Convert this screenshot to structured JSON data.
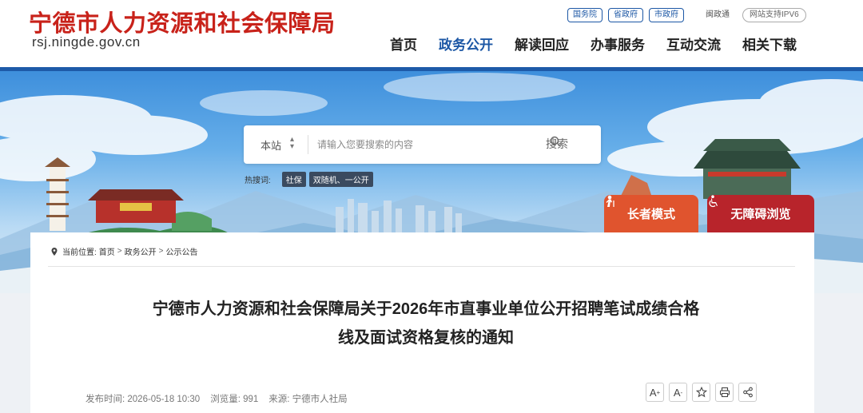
{
  "header": {
    "site_name": "宁德市人力资源和社会保障局",
    "domain": "rsj.ningde.gov.cn",
    "top_links": [
      "国务院",
      "省政府",
      "市政府"
    ],
    "minnan_link": "闽政通",
    "ipv6_badge": "网站支持IPV6",
    "nav": [
      "首页",
      "政务公开",
      "解读回应",
      "办事服务",
      "互动交流",
      "相关下载"
    ],
    "active_nav": "政务公开"
  },
  "search": {
    "scope": "本站",
    "placeholder": "请输入您要搜索的内容",
    "button_label": "搜索",
    "hot_label": "热搜词:",
    "hot_tags": [
      "社保",
      "双随机、一公开"
    ]
  },
  "modes": {
    "elder": "长者模式",
    "barrier_free": "无障碍浏览"
  },
  "breadcrumb": {
    "label": "当前位置:",
    "items": [
      "首页",
      "政务公开",
      "公示公告"
    ]
  },
  "article": {
    "title_line1": "宁德市人力资源和社会保障局关于2026年市直事业单位公开招聘笔试成绩合格",
    "title_line2": "线及面试资格复核的通知",
    "publish_time": "发布时间: 2026-05-18 10:30",
    "views": "浏览量: 991",
    "source": "来源: 宁德市人社局"
  },
  "tools": {
    "font_increase": "A",
    "font_decrease": "A"
  },
  "colors": {
    "brand_red": "#c8221a",
    "brand_blue": "#1d5aa8",
    "elder_orange": "#e0542e",
    "barrier_red": "#b8242b"
  }
}
